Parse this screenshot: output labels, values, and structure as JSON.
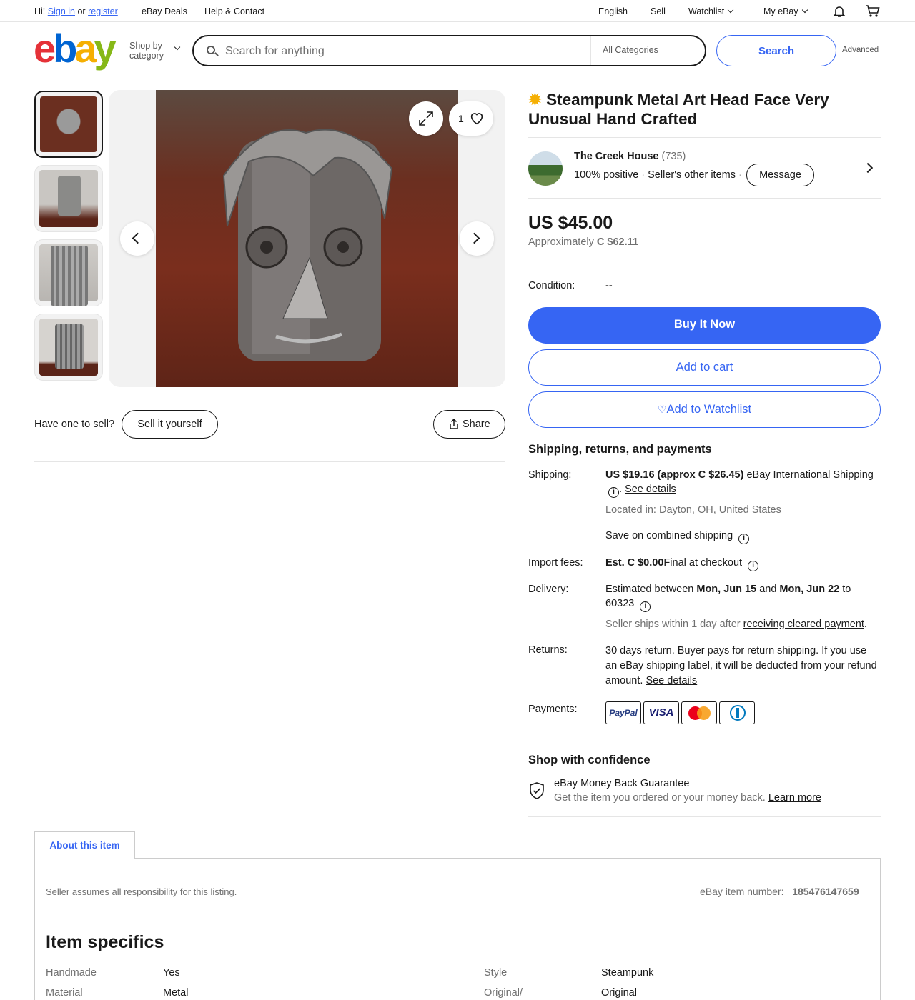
{
  "topbar": {
    "greeting": "Hi!",
    "sign_in": "Sign in",
    "or": "or",
    "register": "register",
    "deals": "eBay Deals",
    "help": "Help & Contact",
    "language": "English",
    "sell": "Sell",
    "watchlist": "Watchlist",
    "my_ebay": "My eBay"
  },
  "header": {
    "logo_letters": [
      "e",
      "b",
      "a",
      "y"
    ],
    "shop_by_line1": "Shop by",
    "shop_by_line2": "category",
    "search_placeholder": "Search for anything",
    "category": "All Categories",
    "search_button": "Search",
    "advanced": "Advanced"
  },
  "gallery": {
    "watch_count": "1"
  },
  "sell_bar": {
    "prompt": "Have one to sell?",
    "sell_button": "Sell it yourself",
    "share_button": "Share"
  },
  "listing": {
    "title": "Steampunk Metal Art Head Face Very Unusual Hand Crafted",
    "seller_name": "The Creek House",
    "seller_feedback": "(735)",
    "seller_positive": "100% positive",
    "seller_other": "Seller's other items",
    "message_button": "Message",
    "price": "US $45.00",
    "approx_label": "Approximately",
    "approx_value": "C $62.11",
    "condition_label": "Condition:",
    "condition_value": "--",
    "buy_now": "Buy It Now",
    "add_to_cart": "Add to cart",
    "add_to_watchlist": "Add to Watchlist"
  },
  "shipping": {
    "heading": "Shipping, returns, and payments",
    "shipping_label": "Shipping:",
    "shipping_cost": "US $19.16 (approx C $26.45)",
    "shipping_method": "eBay International Shipping",
    "see_details": "See details",
    "located": "Located in: Dayton, OH, United States",
    "combined": "Save on combined shipping",
    "import_label": "Import fees:",
    "import_value": "Est. C $0.00",
    "import_note": "Final at checkout",
    "delivery_label": "Delivery:",
    "delivery_pre": "Estimated between",
    "delivery_from": "Mon, Jun 15",
    "delivery_and": "and",
    "delivery_to": "Mon, Jun 22",
    "delivery_zip": "to 60323",
    "ships_pre": "Seller ships within 1 day after",
    "ships_link": "receiving cleared payment",
    "returns_label": "Returns:",
    "returns_text": "30 days return. Buyer pays for return shipping. If you use an eBay shipping label, it will be deducted from your refund amount.",
    "returns_link": "See details",
    "payments_label": "Payments:",
    "payment_methods": [
      "PayPal",
      "VISA"
    ]
  },
  "confidence": {
    "heading": "Shop with confidence",
    "guarantee": "eBay Money Back Guarantee",
    "guarantee_desc": "Get the item you ordered or your money back.",
    "learn_more": "Learn more"
  },
  "about": {
    "tab": "About this item",
    "disclaimer": "Seller assumes all responsibility for this listing.",
    "item_number_label": "eBay item number:",
    "item_number": "185476147659",
    "specifics_heading": "Item specifics",
    "specifics": [
      {
        "label": "Handmade",
        "value": "Yes"
      },
      {
        "label": "Material",
        "value": "Metal"
      },
      {
        "label": "Style",
        "value": "Steampunk"
      },
      {
        "label": "Original/",
        "value": "Original"
      }
    ]
  }
}
